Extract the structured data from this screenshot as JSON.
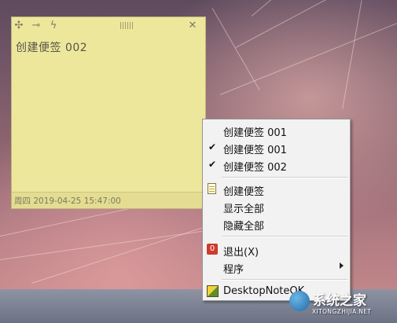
{
  "note": {
    "title": "创建便签 002",
    "date": "周四 2019-04-25 15:47:00",
    "icons": [
      "plus-icon",
      "pin-icon",
      "lightning-icon",
      "grip-icon",
      "close-icon"
    ]
  },
  "menu": {
    "items": [
      {
        "label": "创建便签 001",
        "checked": false
      },
      {
        "label": "创建便签 001",
        "checked": true
      },
      {
        "label": "创建便签 002",
        "checked": true
      },
      {
        "label": "创建便签",
        "icon": "note-icon"
      },
      {
        "label": "显示全部"
      },
      {
        "label": "隐藏全部"
      },
      {
        "label": "退出(X)",
        "icon": "exit-icon"
      },
      {
        "label": "程序",
        "submenu": true
      },
      {
        "label": "DesktopNoteOK",
        "icon": "app-icon"
      }
    ],
    "check_glyph": "✔",
    "exit_glyph": "0"
  },
  "watermark": {
    "text": "系统之家",
    "sub": "XITONGZHIJIA.NET"
  }
}
